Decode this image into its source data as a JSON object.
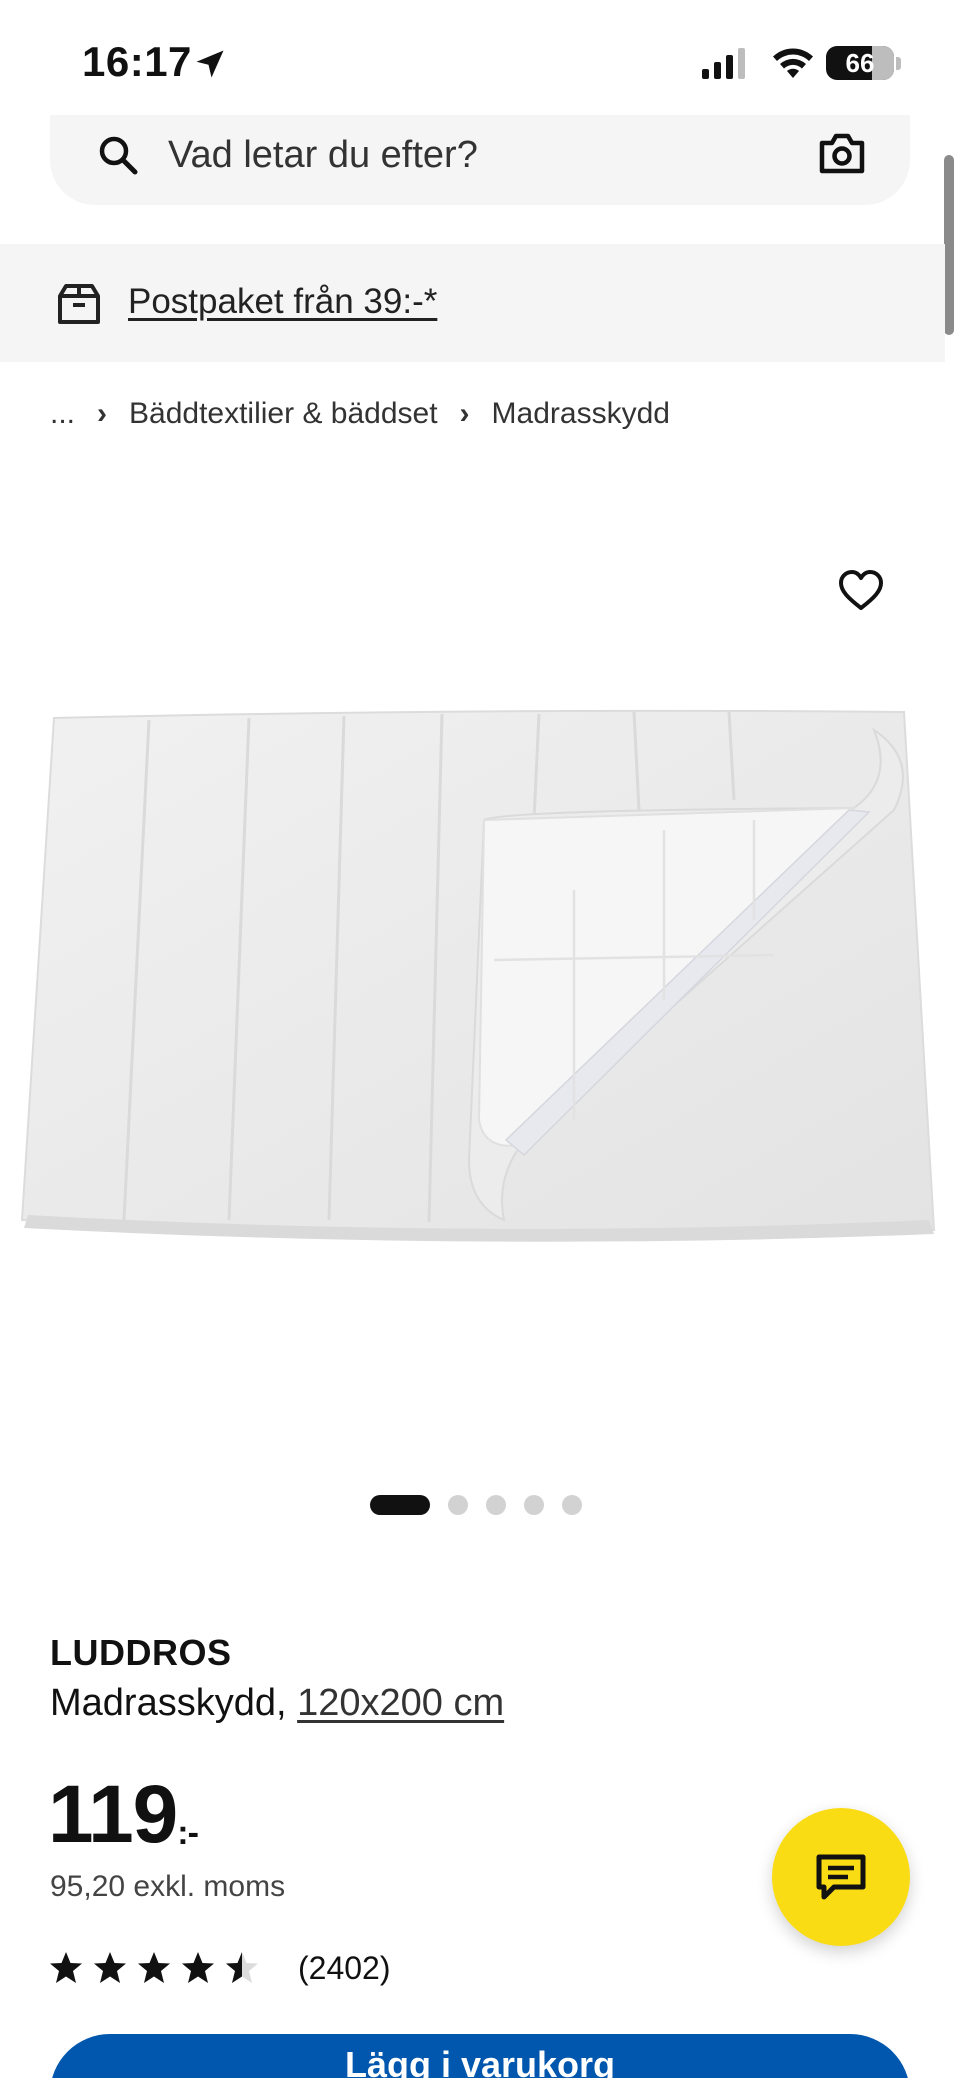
{
  "status_bar": {
    "time": "16:17",
    "battery": "66"
  },
  "search": {
    "placeholder": "Vad letar du efter?"
  },
  "promo": {
    "label": "Postpaket från 39:-*"
  },
  "breadcrumb": {
    "ellipsis": "...",
    "items": [
      "Bäddtextilier & bäddset",
      "Madrasskydd"
    ]
  },
  "gallery": {
    "image_count": 5,
    "active_index": 0
  },
  "product": {
    "name": "LUDDROS",
    "type": "Madrasskydd,",
    "size": "120x200 cm",
    "price": "119",
    "price_suffix": ":-",
    "price_ex_vat": "95,20 exkl. moms",
    "rating": 4.5,
    "rating_max": 5,
    "review_count": "(2402)"
  },
  "cta": {
    "label": "Lägg i varukorg"
  },
  "colors": {
    "cta_blue": "#0057ad",
    "chat_yellow": "#fadc14",
    "surface_gray": "#f5f5f5"
  },
  "icons": [
    "location-arrow-icon",
    "signal-icon",
    "wifi-icon",
    "search-icon",
    "camera-icon",
    "box-icon",
    "heart-icon",
    "star-icon",
    "chat-icon"
  ]
}
